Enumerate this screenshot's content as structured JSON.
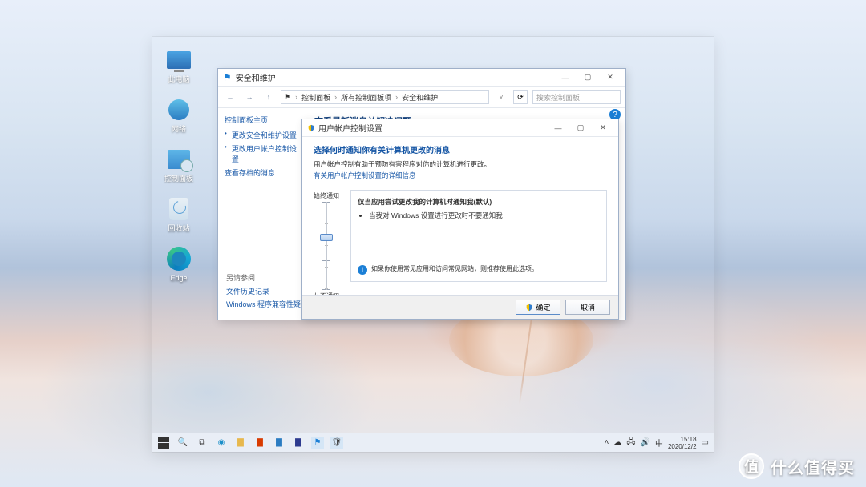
{
  "desktop_icons": {
    "computer": "此电脑",
    "network": "网络",
    "control_panel": "控制面板",
    "recycle_bin": "回收站",
    "edge": "Edge"
  },
  "bgwin": {
    "title": "安全和维护",
    "breadcrumb": {
      "a": "控制面板",
      "b": "所有控制面板项",
      "c": "安全和维护"
    },
    "search_placeholder": "搜索控制面板",
    "sidebar_heading": "控制面板主页",
    "sidebar_links": {
      "l1": "更改安全和维护设置",
      "l2": "更改用户帐户控制设置",
      "l3": "查看存档的消息"
    },
    "main_heading": "查看最新消息并解决问题",
    "see_also_heading": "另请参阅",
    "see_also": {
      "l1": "文件历史记录",
      "l2": "Windows 程序兼容性疑难解答"
    }
  },
  "uac": {
    "title": "用户帐户控制设置",
    "heading": "选择何时通知你有关计算机更改的消息",
    "desc": "用户帐户控制有助于预防有害程序对你的计算机进行更改。",
    "more_link": "有关用户帐户控制设置的详细信息",
    "slider_top": "始终通知",
    "slider_bottom": "从不通知",
    "box_heading": "仅当应用尝试更改我的计算机时通知我(默认)",
    "box_bullet": "当我对 Windows 设置进行更改时不要通知我",
    "box_note": "如果你使用常见应用和访问常见网站，则推荐使用此选项。",
    "ok": "确定",
    "cancel": "取消"
  },
  "taskbar": {
    "time": "15:18",
    "date": "2020/12/2",
    "ime": "中"
  },
  "watermark": {
    "char": "值",
    "text": "什么值得买"
  }
}
